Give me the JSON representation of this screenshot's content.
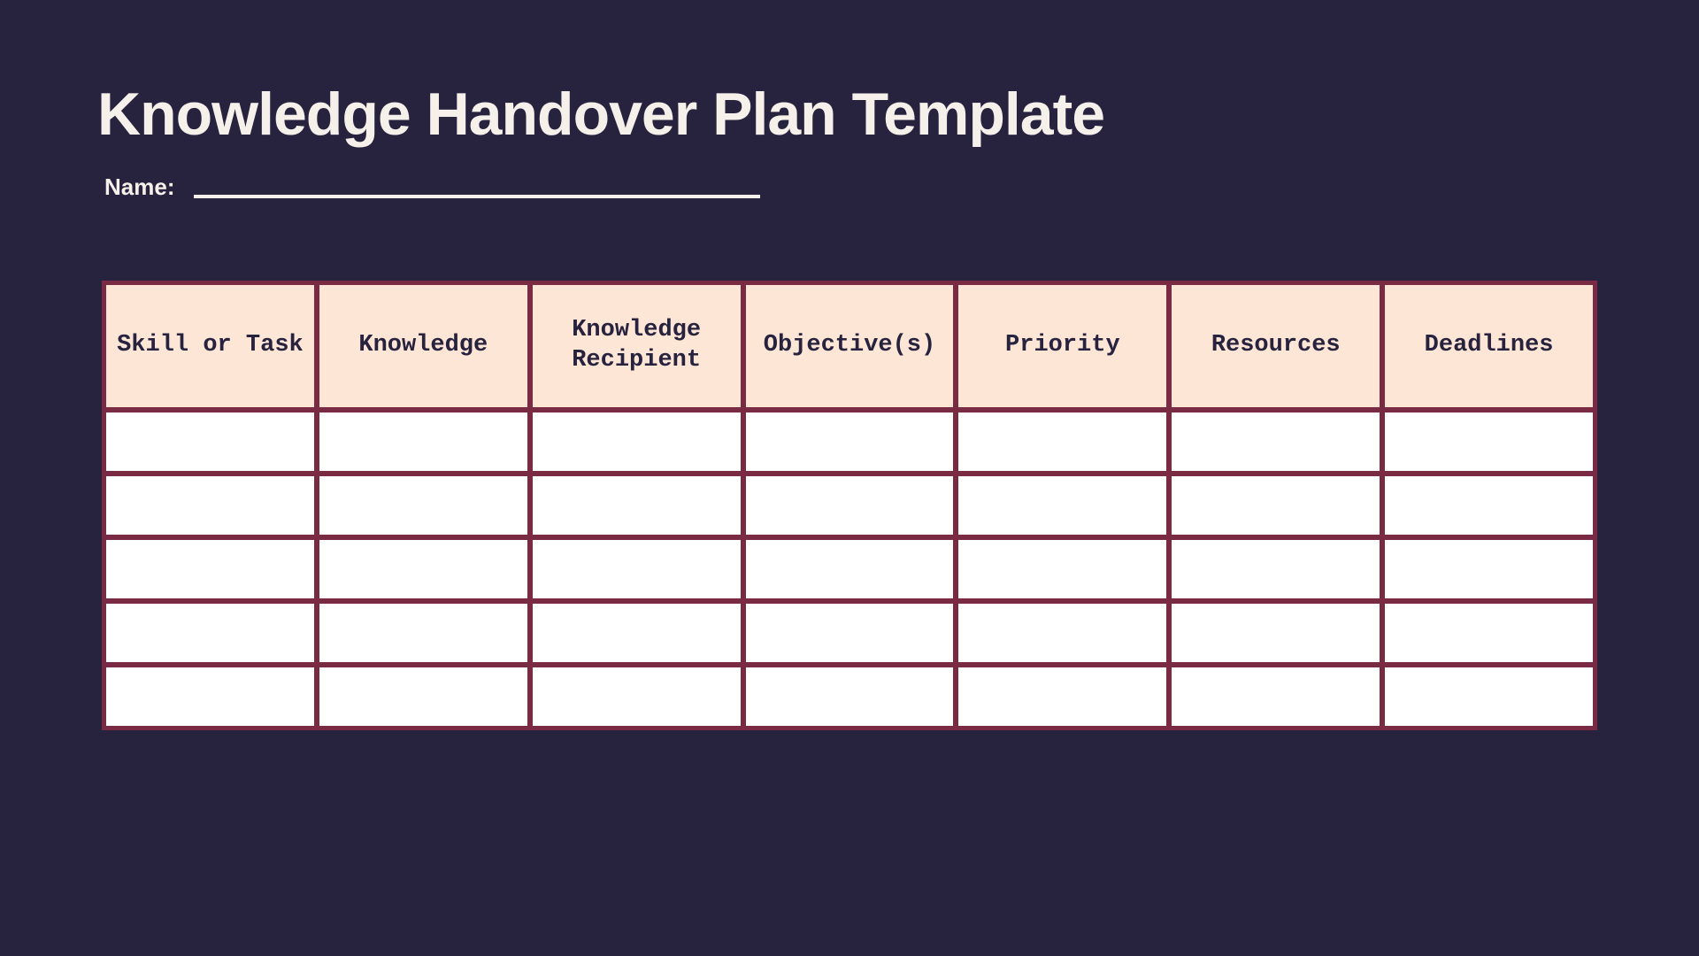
{
  "title": "Knowledge Handover Plan Template",
  "nameLabel": "Name:",
  "nameValue": "",
  "table": {
    "headers": [
      "Skill or Task",
      "Knowledge",
      "Knowledge Recipient",
      "Objective(s)",
      "Priority",
      "Resources",
      "Deadlines"
    ],
    "rows": [
      [
        "",
        "",
        "",
        "",
        "",
        "",
        ""
      ],
      [
        "",
        "",
        "",
        "",
        "",
        "",
        ""
      ],
      [
        "",
        "",
        "",
        "",
        "",
        "",
        ""
      ],
      [
        "",
        "",
        "",
        "",
        "",
        "",
        ""
      ],
      [
        "",
        "",
        "",
        "",
        "",
        "",
        ""
      ]
    ]
  },
  "colors": {
    "background": "#27233f",
    "headerFill": "#fde6d6",
    "border": "#7a2a42",
    "text": "#f5f0e9",
    "cellFill": "#ffffff"
  }
}
